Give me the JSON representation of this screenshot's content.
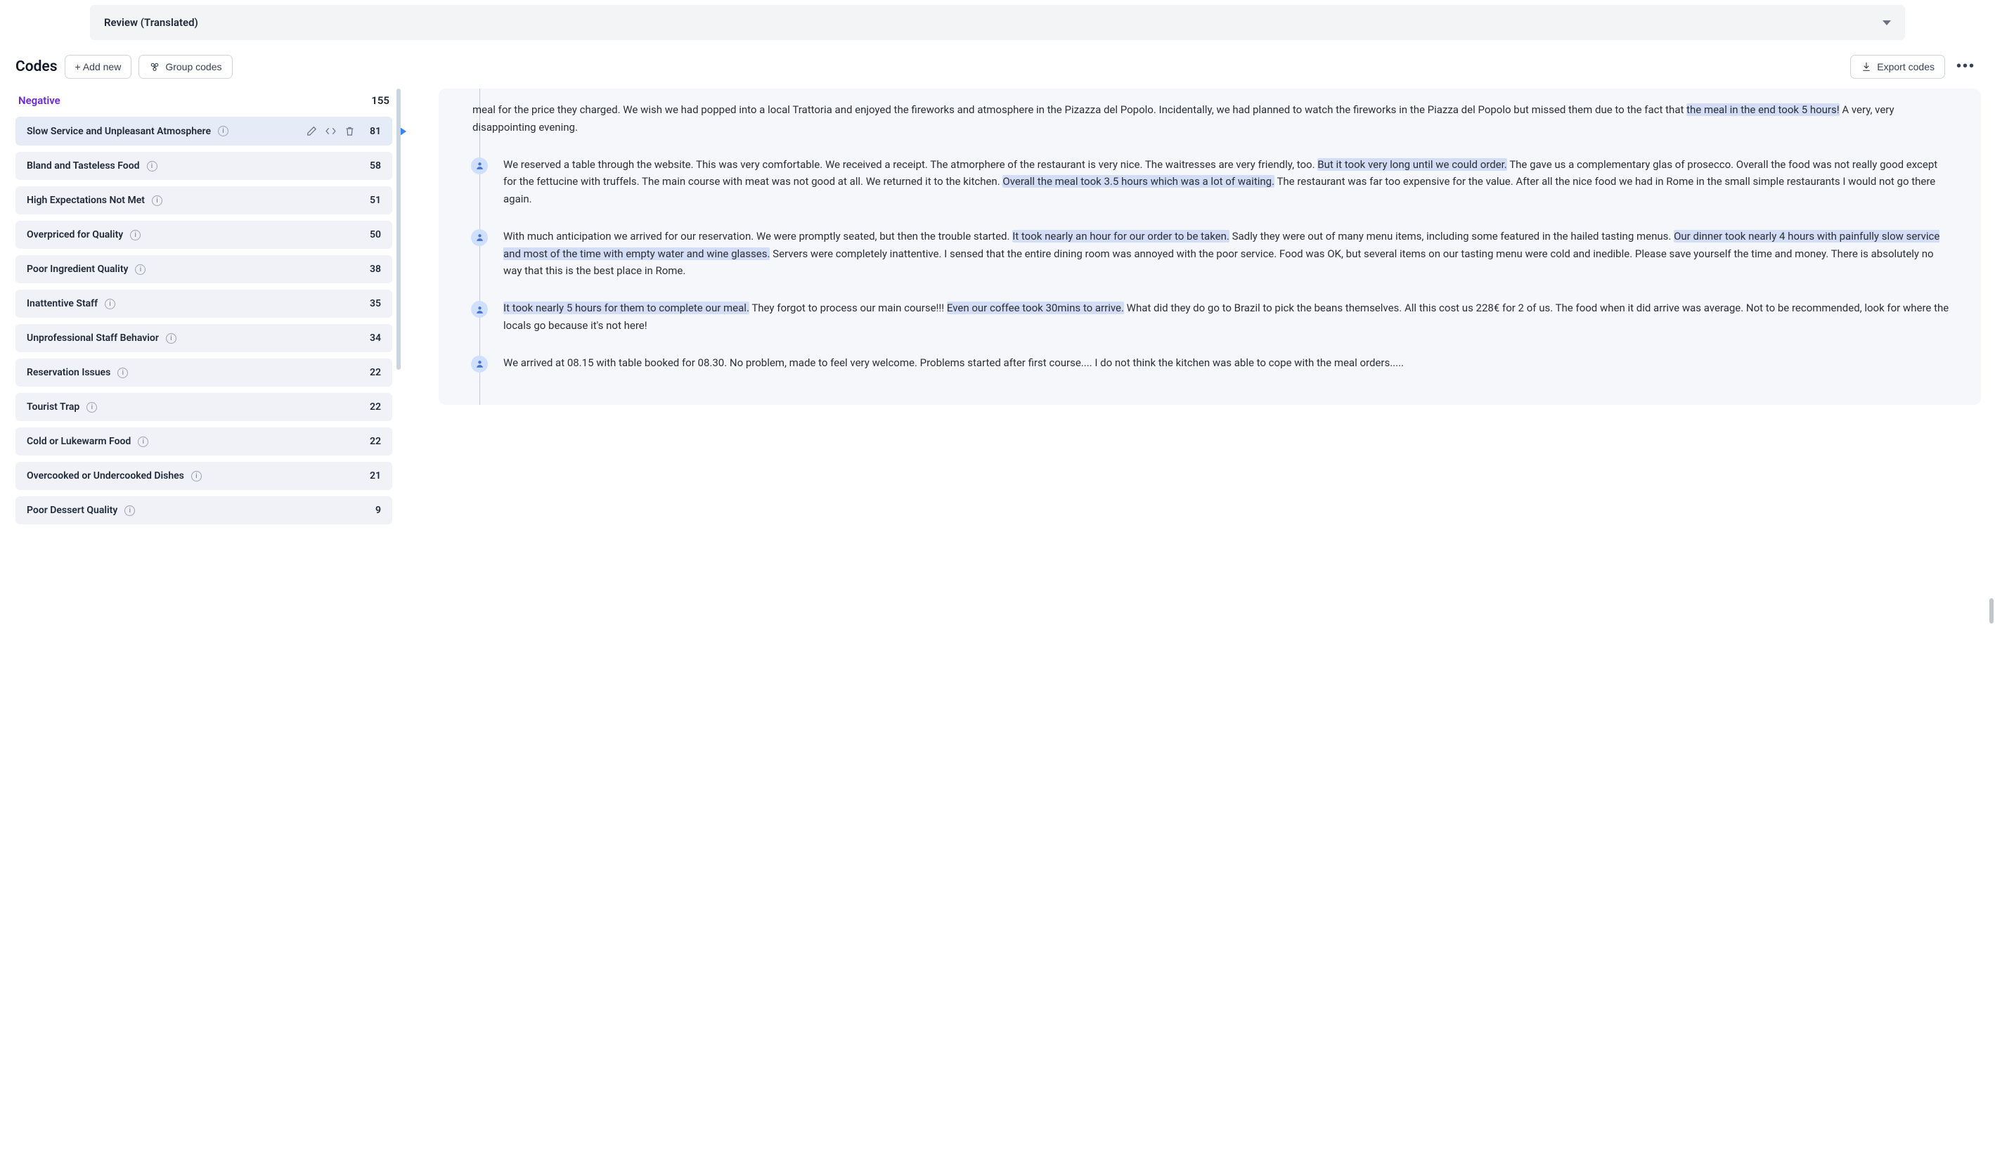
{
  "topBar": {
    "title": "Review (Translated)"
  },
  "codesHeader": {
    "title": "Codes",
    "addNew": "+ Add new",
    "groupCodes": "Group codes",
    "exportCodes": "Export codes"
  },
  "category": {
    "name": "Negative",
    "count": "155"
  },
  "codes": [
    {
      "label": "Slow Service and Unpleasant Atmosphere",
      "count": "81",
      "selected": true
    },
    {
      "label": "Bland and Tasteless Food",
      "count": "58"
    },
    {
      "label": "High Expectations Not Met",
      "count": "51"
    },
    {
      "label": "Overpriced for Quality",
      "count": "50"
    },
    {
      "label": "Poor Ingredient Quality",
      "count": "38"
    },
    {
      "label": "Inattentive Staff",
      "count": "35"
    },
    {
      "label": "Unprofessional Staff Behavior",
      "count": "34"
    },
    {
      "label": "Reservation Issues",
      "count": "22"
    },
    {
      "label": "Tourist Trap",
      "count": "22"
    },
    {
      "label": "Cold or Lukewarm Food",
      "count": "22"
    },
    {
      "label": "Overcooked or Undercooked Dishes",
      "count": "21"
    },
    {
      "label": "Poor Dessert Quality",
      "count": "9"
    }
  ],
  "reviews": [
    {
      "noAvatar": true,
      "segments": [
        {
          "t": "meal for the price they charged. We wish we had popped into a local Trattoria and enjoyed the fireworks and atmosphere in the Pizazza del Popolo. Incidentally, we had planned to watch the fireworks in the Piazza del Popolo but missed them due to the fact that "
        },
        {
          "t": "the meal in the end took 5 hours!",
          "hl": true
        },
        {
          "t": " A very, very disappointing evening."
        }
      ]
    },
    {
      "segments": [
        {
          "t": "We reserved a table through the website. This was very comfortable. We received a receipt. The atmorphere of the restaurant is very nice. The waitresses are very friendly, too. "
        },
        {
          "t": "But it took very long until we could order.",
          "hl": true
        },
        {
          "t": " The gave us a complementary glas of prosecco. Overall the food was not really good except for the fettucine with truffels. The main course with meat was not good at all. We returned it to the kitchen. "
        },
        {
          "t": "Overall the meal took 3.5 hours which was a lot of waiting.",
          "hl": true
        },
        {
          "t": " The restaurant was far too expensive for the value. After all the nice food we had in Rome in the small simple restaurants I would not go there again."
        }
      ]
    },
    {
      "segments": [
        {
          "t": "With much anticipation we arrived for our reservation. We were promptly seated, but then the trouble started. "
        },
        {
          "t": "It took nearly an hour for our order to be taken.",
          "hl": true
        },
        {
          "t": " Sadly they were out of many menu items, including some featured in the hailed tasting menus. "
        },
        {
          "t": "Our dinner took nearly 4 hours with painfully slow service and most of the time with empty water and wine glasses.",
          "hl": true
        },
        {
          "t": " Servers were completely inattentive. I sensed that the entire dining room was annoyed with the poor service. Food was OK, but several items on our tasting menu were cold and inedible. Please save yourself the time and money. There is absolutely no way that this is the best place in Rome."
        }
      ]
    },
    {
      "segments": [
        {
          "t": "It took nearly 5 hours for them to complete our meal.",
          "hl": true
        },
        {
          "t": " They forgot to process our main course!!! "
        },
        {
          "t": "Even our coffee took 30mins to arrive.",
          "hl": true
        },
        {
          "t": " What did they do go to Brazil to pick the beans themselves. All this cost us 228€ for 2 of us. The food when it did arrive was average. Not to be recommended, look for where the locals go because it's not here!"
        }
      ]
    },
    {
      "segments": [
        {
          "t": "We arrived at 08.15 with table booked for 08.30. No problem, made to feel very welcome. Problems started after first course.... I do not think the kitchen was able to cope with the meal orders....."
        }
      ]
    }
  ]
}
